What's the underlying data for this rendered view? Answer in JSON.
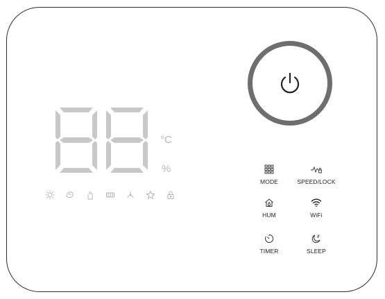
{
  "display": {
    "digits": "88",
    "temperature_unit": "°C",
    "humidity_unit": "%",
    "segment_color": "#c8c8c8"
  },
  "power_button": {
    "icon": "power-icon"
  },
  "status_icons": [
    {
      "name": "heat-sun-icon"
    },
    {
      "name": "drying-icon"
    },
    {
      "name": "hand-wash-icon"
    },
    {
      "name": "filter-icon"
    },
    {
      "name": "fan-icon"
    },
    {
      "name": "star-icon"
    },
    {
      "name": "lock-icon"
    }
  ],
  "controls": {
    "mode": {
      "label": "MODE",
      "icon": "mode-grid-icon"
    },
    "speed_lock": {
      "label": "SPEED/LOCK",
      "icon": "speed-lock-icon"
    },
    "hum": {
      "label": "HUM",
      "icon": "humidity-home-icon"
    },
    "wifi": {
      "label": "WiFi",
      "icon": "wifi-icon"
    },
    "timer": {
      "label": "TIMER",
      "icon": "timer-icon"
    },
    "sleep": {
      "label": "SLEEP",
      "icon": "sleep-moon-icon"
    }
  },
  "colors": {
    "outline": "#2b2b2b",
    "power_ring": "#6e6e6e",
    "inactive": "#c8c8c8",
    "label": "#1f1f1f"
  }
}
